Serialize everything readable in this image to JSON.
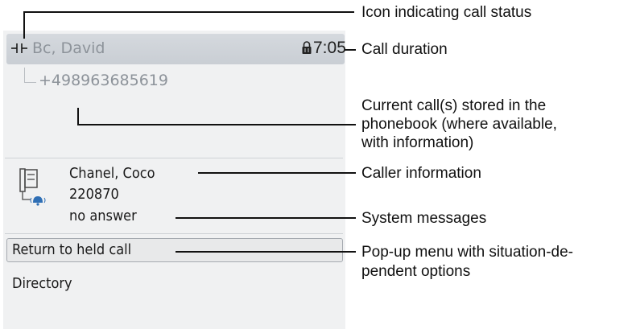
{
  "call": {
    "name": "Bc, David",
    "duration": "7:05",
    "number": "+498963685619"
  },
  "contact": {
    "name": "Chanel, Coco",
    "number": "220870",
    "system_message": "no answer"
  },
  "menu": {
    "items": [
      "Return to held call",
      "Directory"
    ],
    "selected_index": 0
  },
  "callouts": {
    "status_icon": "Icon indicating call status",
    "duration": "Call duration",
    "phonebook": [
      "Current call(s) stored in the",
      "phonebook (where available,",
      "with information)"
    ],
    "caller_info": "Caller information",
    "system_messages": "System messages",
    "popup_menu": [
      "Pop-up menu with situation-de-",
      "pendent options"
    ]
  },
  "icons": {
    "status": "held-call-icon",
    "lock": "lock-icon",
    "contact": "phone-ringing-icon"
  },
  "colors": {
    "header_bg": "#cdd2d7",
    "screen_bg": "#f0f1f2",
    "dim_text": "#8d939a"
  }
}
